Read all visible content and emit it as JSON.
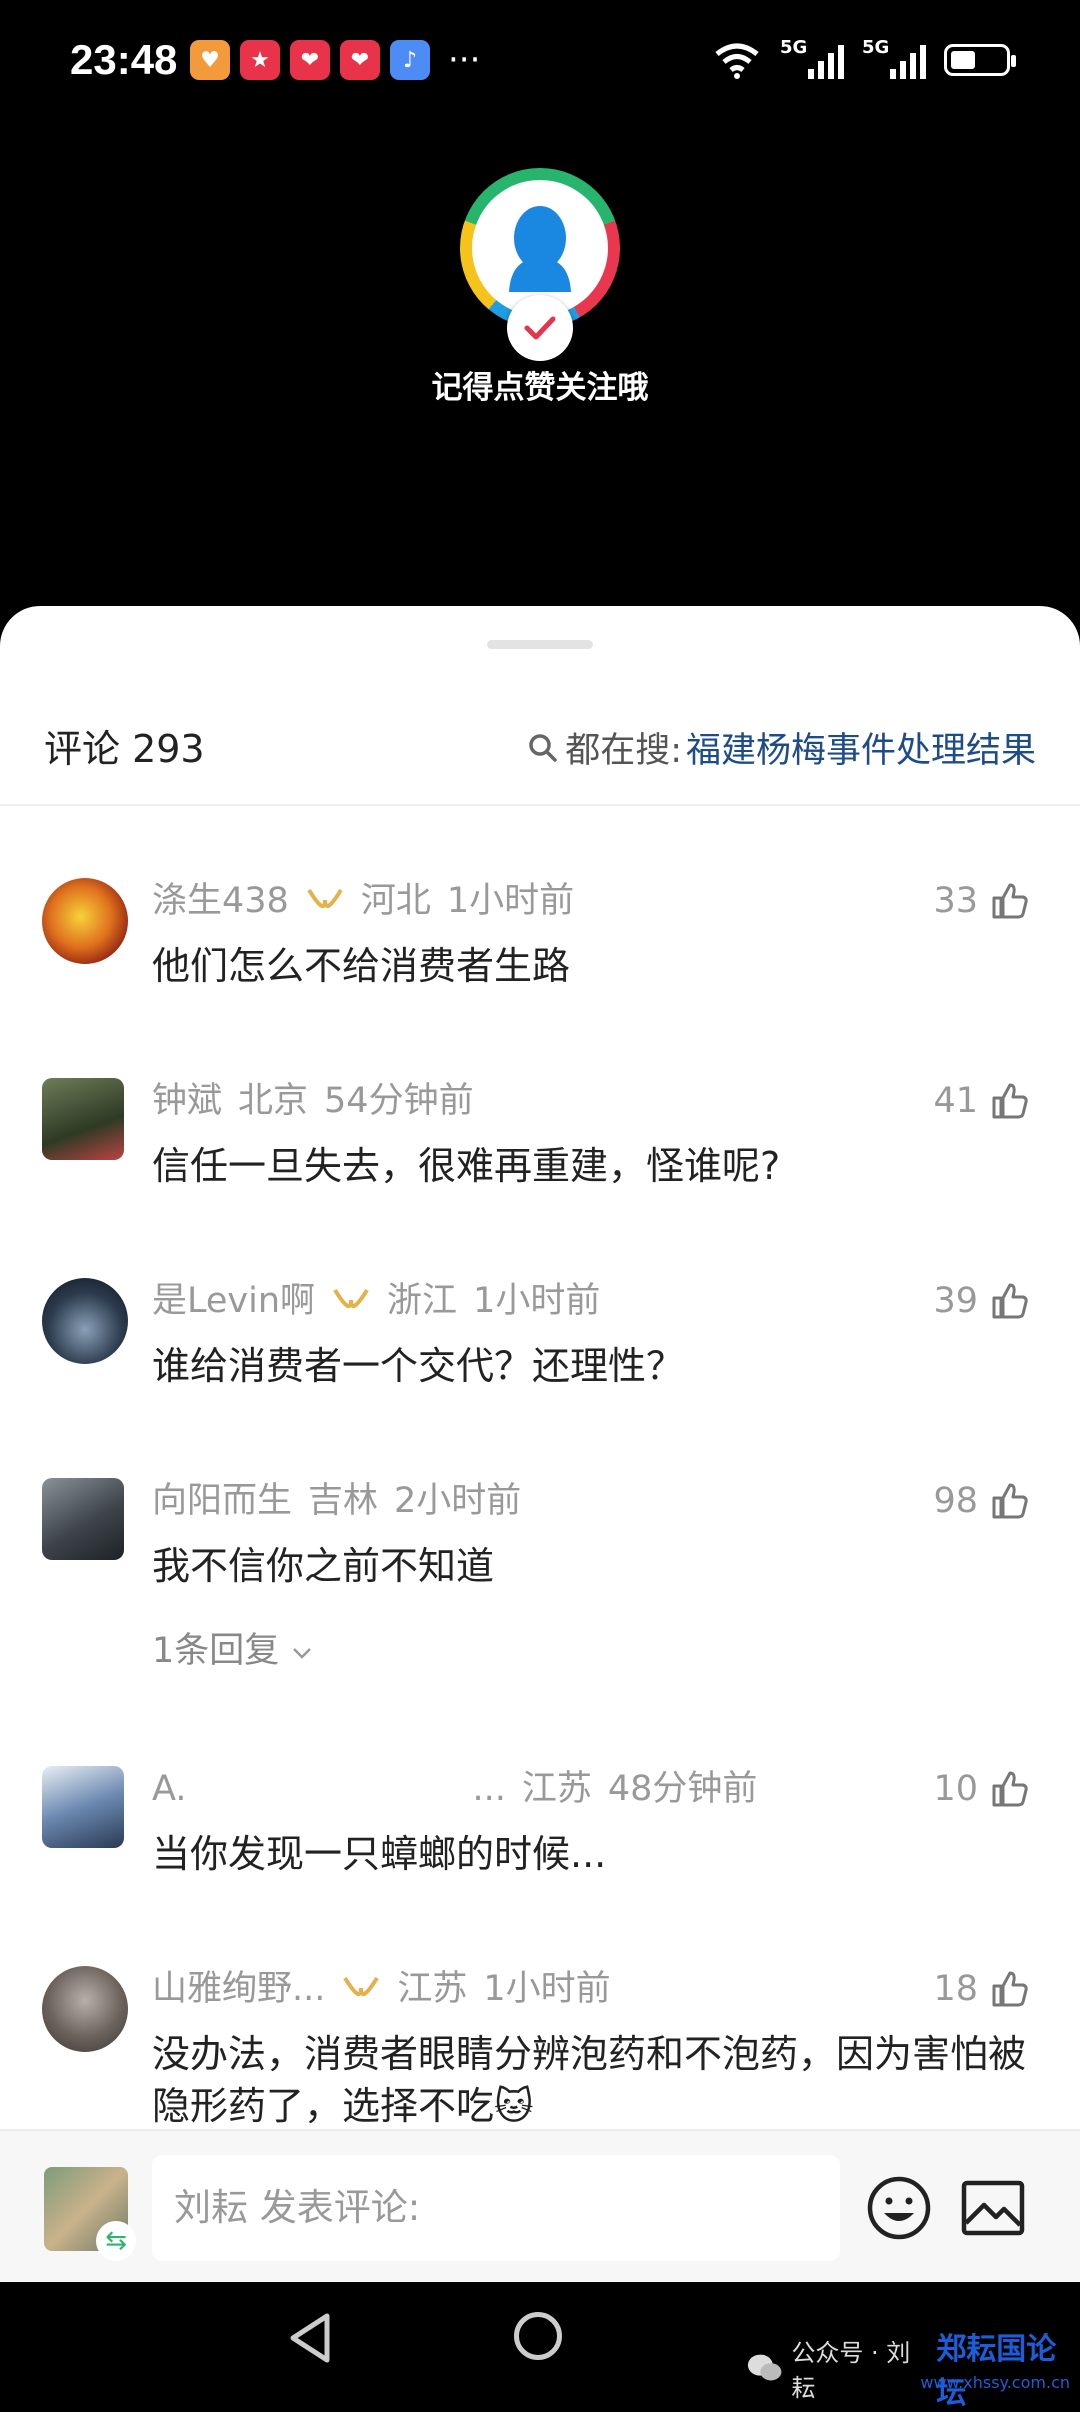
{
  "status_bar": {
    "time": "23:48",
    "network_1": "5G",
    "network_2": "5G",
    "wifi_label": "6",
    "more": "···"
  },
  "creator": {
    "follow_prompt": "记得点赞关注哦"
  },
  "comments_panel": {
    "count_label": "评论 293",
    "hot_search_label": "都在搜:",
    "hot_search_term": "福建杨梅事件处理结果"
  },
  "comments": [
    {
      "user": "涤生438",
      "region": "河北",
      "time": "1小时前",
      "text": "他们怎么不给消费者生路",
      "likes": "33",
      "badge": "gold"
    },
    {
      "user": "钟斌",
      "region": "北京",
      "time": "54分钟前",
      "text": "信任一旦失去，很难再重建，怪谁呢?",
      "likes": "41"
    },
    {
      "user": "是Levin啊",
      "region": "浙江",
      "time": "1小时前",
      "text": "谁给消费者一个交代？还理性？",
      "likes": "39",
      "badge": "gold"
    },
    {
      "user": "向阳而生",
      "region": "吉林",
      "time": "2小时前",
      "text": "我不信你之前不知道",
      "likes": "98",
      "replies": "1条回复"
    },
    {
      "user": "A.",
      "ellipsis": "...",
      "region": "江苏",
      "time": "48分钟前",
      "text": "当你发现一只蟑螂的时候...",
      "likes": "10"
    },
    {
      "user": "山雅绚野...",
      "region": "江苏",
      "time": "1小时前",
      "text": "没办法，消费者眼睛分辨泡药和不泡药，因为害怕被隐形药了，选择不吃🐱",
      "likes": "18",
      "badge": "gold"
    }
  ],
  "input_bar": {
    "placeholder": "刘耘 发表评论:"
  },
  "nav_bar": {
    "watermark": "公众号 · 刘耘",
    "watermark_brand": "郑耘国论坛",
    "watermark_url": "www.xhssy.com.cn"
  },
  "colors": {
    "accent_link": "#1e4c8a",
    "badge_gold": "#e6b04a",
    "swap_green": "#2fb36b"
  }
}
